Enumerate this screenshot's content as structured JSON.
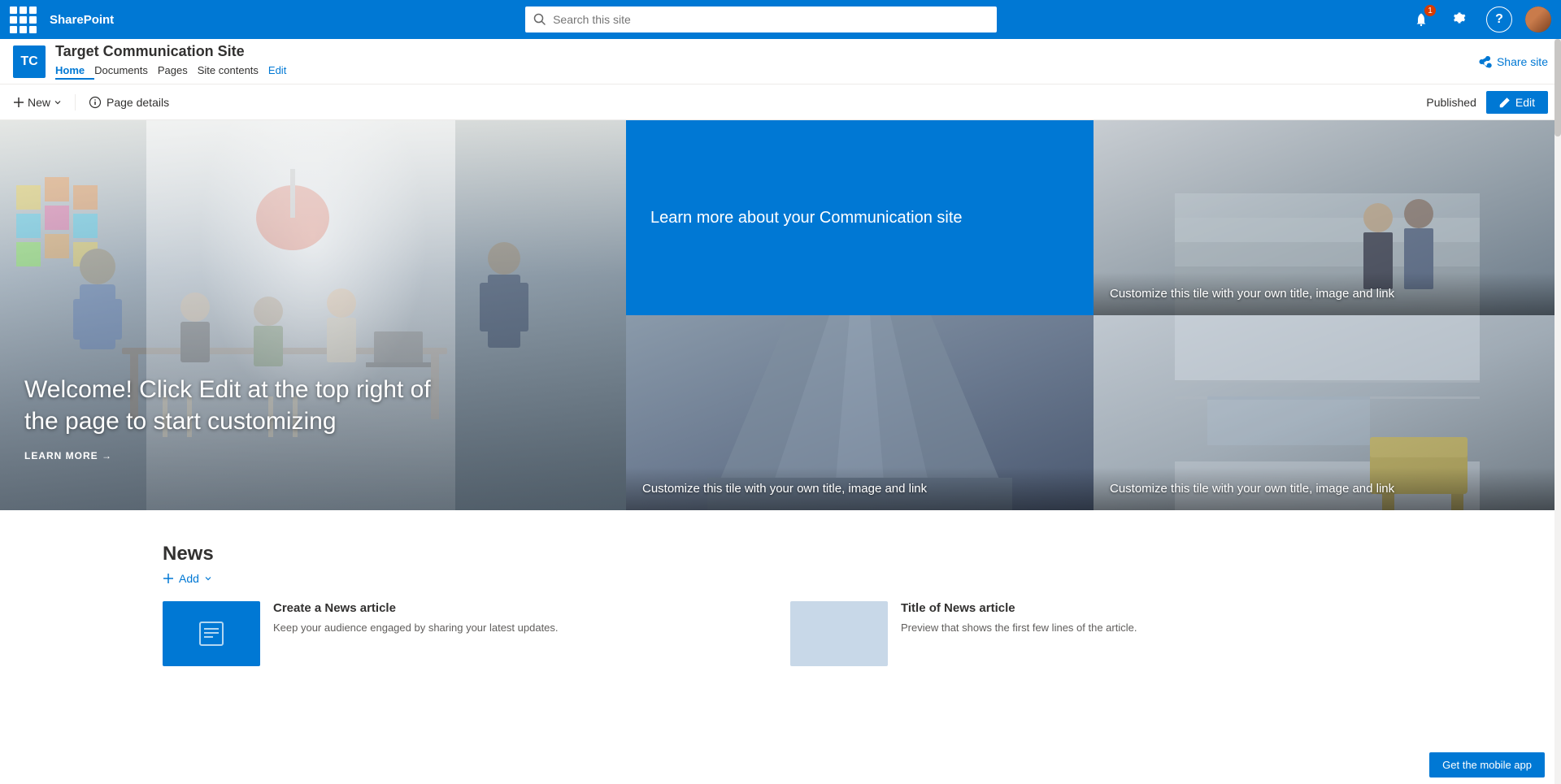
{
  "topnav": {
    "brand": "SharePoint",
    "search_placeholder": "Search this site",
    "notification_count": "1",
    "icons": {
      "bell": "🔔",
      "settings": "⚙",
      "help": "?"
    }
  },
  "site_header": {
    "logo_text": "TC",
    "site_title": "Target Communication Site",
    "nav_items": [
      {
        "label": "Home",
        "active": true
      },
      {
        "label": "Documents",
        "active": false
      },
      {
        "label": "Pages",
        "active": false
      },
      {
        "label": "Site contents",
        "active": false
      },
      {
        "label": "Edit",
        "active": false,
        "edit": true
      }
    ],
    "share_label": "Share site"
  },
  "toolbar": {
    "new_label": "New",
    "page_details_label": "Page details",
    "published_label": "Published",
    "edit_label": "Edit"
  },
  "hero": {
    "main_title": "Welcome! Click Edit at the top right of the page to start customizing",
    "learn_more_label": "LEARN MORE →",
    "tile_1_text": "Learn more about your Communication site",
    "tile_2_caption": "Customize this tile with your own title, image and link",
    "tile_3_caption": "Customize this tile with your own title, image and link",
    "tile_4_caption": "Customize this tile with your own title, image and link"
  },
  "news": {
    "section_title": "News",
    "add_label": "+ Add",
    "cards": [
      {
        "title": "Create a News article",
        "description": "Keep your audience engaged by sharing your latest updates."
      },
      {
        "title": "Title of News article",
        "description": "Preview that shows the first few lines of the article."
      }
    ]
  },
  "footer": {
    "mobile_app_label": "Get the mobile app"
  }
}
